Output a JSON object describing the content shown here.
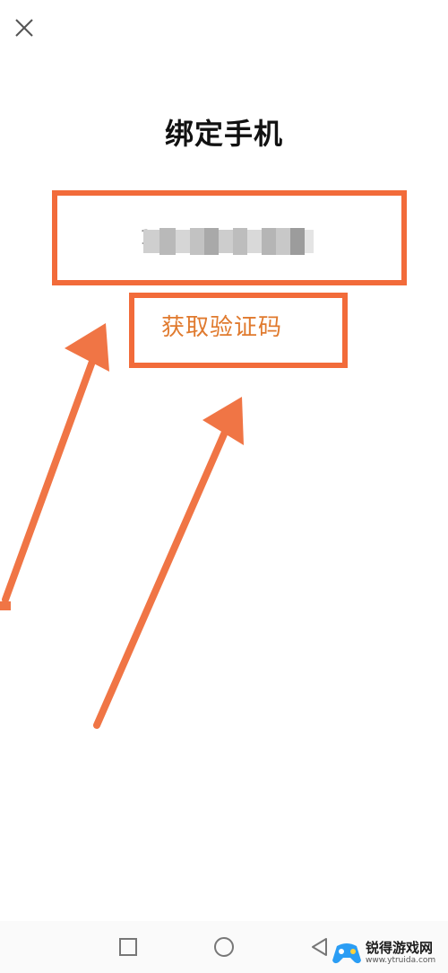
{
  "colors": {
    "accent": "#F26B3A",
    "code_text": "#E07A2E",
    "arrow": "#F07545"
  },
  "header": {
    "close_icon": "close-icon",
    "title": "绑定手机"
  },
  "phone": {
    "value": "1"
  },
  "verify": {
    "label": "获取验证码"
  },
  "nav": {
    "recent_icon": "square-icon",
    "home_icon": "circle-icon",
    "back_icon": "triangle-back-icon"
  },
  "watermark": {
    "name": "锐得游戏网",
    "url": "www.ytruida.com"
  }
}
